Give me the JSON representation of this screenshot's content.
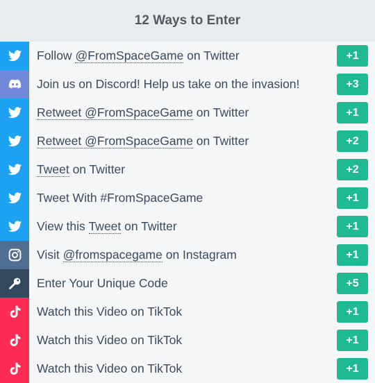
{
  "header": {
    "title": "12 Ways to Enter"
  },
  "colors": {
    "twitter": "#1da1f2",
    "discord": "#7289da",
    "instagram": "#4f6e91",
    "code": "#34495e",
    "tiktok": "#fe2c55",
    "points_badge": "#1fb992"
  },
  "entries": [
    {
      "icon": "twitter-icon",
      "pre": "Follow ",
      "link": "@FromSpaceGame",
      "post": " on Twitter",
      "points": "+1"
    },
    {
      "icon": "discord-icon",
      "pre": "Join us on Discord! Help us take on the invasion!",
      "link": "",
      "post": "",
      "points": "+3"
    },
    {
      "icon": "twitter-icon",
      "pre": "",
      "link": "Retweet @FromSpaceGame",
      "post": " on Twitter",
      "points": "+1"
    },
    {
      "icon": "twitter-icon",
      "pre": "",
      "link": "Retweet @FromSpaceGame",
      "post": " on Twitter",
      "points": "+2"
    },
    {
      "icon": "twitter-icon",
      "pre": "",
      "link": "Tweet",
      "post": " on Twitter",
      "points": "+2"
    },
    {
      "icon": "twitter-icon",
      "pre": "Tweet With #FromSpaceGame",
      "link": "",
      "post": "",
      "points": "+1"
    },
    {
      "icon": "twitter-icon",
      "pre": "View this ",
      "link": "Tweet",
      "post": " on Twitter",
      "points": "+1"
    },
    {
      "icon": "instagram-icon",
      "pre": "Visit ",
      "link": "@fromspacegame",
      "post": " on Instagram",
      "points": "+1"
    },
    {
      "icon": "key-icon",
      "pre": "Enter Your Unique Code",
      "link": "",
      "post": "",
      "points": "+5"
    },
    {
      "icon": "tiktok-icon",
      "pre": "Watch this Video on TikTok",
      "link": "",
      "post": "",
      "points": "+1"
    },
    {
      "icon": "tiktok-icon",
      "pre": "Watch this Video on TikTok",
      "link": "",
      "post": "",
      "points": "+1"
    },
    {
      "icon": "tiktok-icon",
      "pre": "Watch this Video on TikTok",
      "link": "",
      "post": "",
      "points": "+1"
    }
  ]
}
